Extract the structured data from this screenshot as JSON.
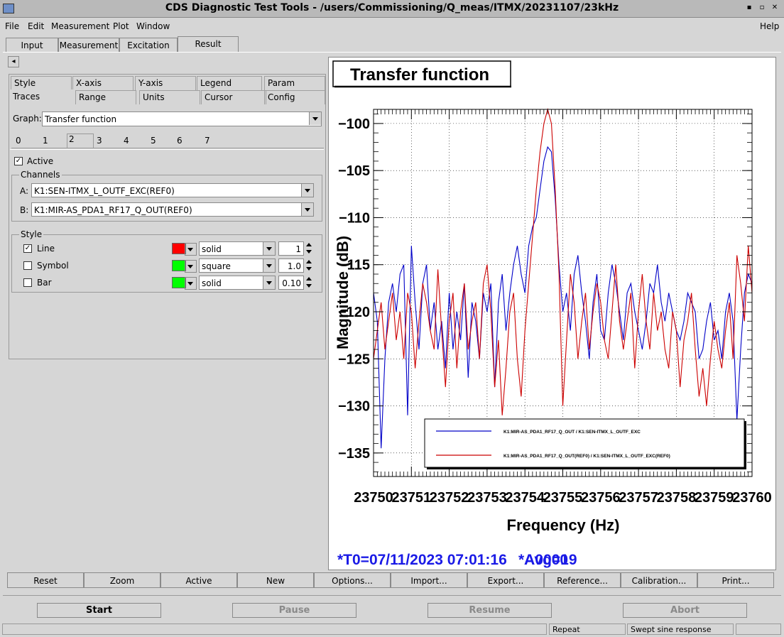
{
  "window": {
    "title": "CDS Diagnostic Test Tools - /users/Commissioning/Q_meas/ITMX/20231107/23kHz",
    "minimize": "▪",
    "maximize": "▫",
    "close": "✕"
  },
  "menu": [
    "File",
    "Edit",
    "Measurement",
    "Plot",
    "Window"
  ],
  "menu_help": "Help",
  "main_tabs": [
    "Input",
    "Measurement",
    "Excitation",
    "Result"
  ],
  "main_tab_selected": "Result",
  "nav_arrow": "◂",
  "option_tabs_row1": [
    "Style",
    "X-axis",
    "Y-axis",
    "Legend",
    "Param"
  ],
  "option_tabs_row2": [
    "Traces",
    "Range",
    "Units",
    "Cursor",
    "Config"
  ],
  "graph_label": "Graph:",
  "graph_value": "Transfer function",
  "trace_tabs": [
    "0",
    "1",
    "2",
    "3",
    "4",
    "5",
    "6",
    "7"
  ],
  "trace_selected": "2",
  "active_label": "Active",
  "active_checked": "✓",
  "channels_label": "Channels",
  "channel_a_label": "A:",
  "channel_a_value": "K1:SEN-ITMX_L_OUTF_EXC(REF0)",
  "channel_b_label": "B:",
  "channel_b_value": "K1:MIR-AS_PDA1_RF17_Q_OUT(REF0)",
  "style_label": "Style",
  "style_rows": [
    {
      "label": "Line",
      "checked": "✓",
      "color": "#ff0000",
      "type": "solid",
      "size": "1"
    },
    {
      "label": "Symbol",
      "checked": "",
      "color": "#00ff00",
      "type": "square",
      "size": "1.0"
    },
    {
      "label": "Bar",
      "checked": "",
      "color": "#00ff00",
      "type": "solid",
      "size": "0.10"
    }
  ],
  "plot": {
    "title": "Transfer function",
    "footer_text": "*T0=07/11/2023 07:01:16",
    "footer_avg": "Avg=19",
    "footer_overlap": "*A0000",
    "trace_colors": [
      "#0000c8",
      "#cc0000"
    ]
  },
  "chart_data": {
    "type": "line",
    "title": "Transfer function",
    "xlabel": "Frequency (Hz)",
    "ylabel": "Magnitude (dB)",
    "xlim": [
      23750,
      23760
    ],
    "ylim": [
      -137.5,
      -98.5
    ],
    "xticks": [
      "23750",
      "23751",
      "23752",
      "23753",
      "23754",
      "23755",
      "23756",
      "23757",
      "23758",
      "23759",
      "23760"
    ],
    "yticks": [
      "−100",
      "−105",
      "−110",
      "−115",
      "−120",
      "−125",
      "−130",
      "−135"
    ],
    "ytick_values": [
      -100,
      -105,
      -110,
      -115,
      -120,
      -125,
      -130,
      -135
    ],
    "legend_position": "bottom-right",
    "grid": true,
    "series": [
      {
        "name": "K1:MIR-AS_PDA1_RF17_Q_OUT / K1:SEN-ITMX_L_OUTF_EXC",
        "color": "#0000c8",
        "x": [
          23750.0,
          23750.1,
          23750.2,
          23750.3,
          23750.4,
          23750.5,
          23750.6,
          23750.7,
          23750.8,
          23750.9,
          23751.0,
          23751.1,
          23751.2,
          23751.3,
          23751.4,
          23751.5,
          23751.6,
          23751.7,
          23751.8,
          23751.9,
          23752.0,
          23752.1,
          23752.2,
          23752.3,
          23752.4,
          23752.5,
          23752.6,
          23752.7,
          23752.8,
          23752.9,
          23753.0,
          23753.1,
          23753.2,
          23753.3,
          23753.4,
          23753.5,
          23753.6,
          23753.7,
          23753.8,
          23753.9,
          23754.0,
          23754.1,
          23754.2,
          23754.3,
          23754.4,
          23754.5,
          23754.6,
          23754.7,
          23754.8,
          23754.9,
          23755.0,
          23755.1,
          23755.2,
          23755.3,
          23755.4,
          23755.5,
          23755.6,
          23755.7,
          23755.8,
          23755.9,
          23756.0,
          23756.1,
          23756.2,
          23756.3,
          23756.4,
          23756.5,
          23756.6,
          23756.7,
          23756.8,
          23756.9,
          23757.0,
          23757.1,
          23757.2,
          23757.3,
          23757.4,
          23757.5,
          23757.6,
          23757.7,
          23757.8,
          23757.9,
          23758.0,
          23758.1,
          23758.2,
          23758.3,
          23758.4,
          23758.5,
          23758.6,
          23758.7,
          23758.8,
          23758.9,
          23759.0,
          23759.1,
          23759.2,
          23759.3,
          23759.4,
          23759.5,
          23759.6,
          23759.7,
          23759.8,
          23759.9,
          23760.0
        ],
        "values": [
          -118,
          -121,
          -134.5,
          -125,
          -119,
          -117,
          -120,
          -116,
          -115,
          -131,
          -113,
          -119,
          -124,
          -117,
          -115,
          -122,
          -119,
          -124,
          -121,
          -126,
          -118,
          -124,
          -120,
          -123,
          -117,
          -127,
          -119,
          -121,
          -125,
          -118,
          -120,
          -117,
          -128,
          -119,
          -116,
          -122,
          -118,
          -115,
          -113,
          -116,
          -118,
          -113,
          -111,
          -110,
          -107,
          -104,
          -102.5,
          -103,
          -108,
          -115,
          -120,
          -118,
          -122,
          -116,
          -114,
          -118,
          -121,
          -125,
          -119,
          -116,
          -122,
          -123,
          -118,
          -115,
          -117,
          -120,
          -123,
          -118,
          -117,
          -120,
          -122,
          -124,
          -121,
          -117,
          -118,
          -115,
          -119,
          -121,
          -118,
          -120,
          -122,
          -123,
          -121,
          -118,
          -119,
          -120,
          -125,
          -124,
          -121,
          -119,
          -123,
          -122,
          -125,
          -120,
          -118,
          -121,
          -131.5,
          -124,
          -118,
          -116,
          -117
        ]
      },
      {
        "name": "K1:MIR-AS_PDA1_RF17_Q_OUT(REF0) / K1:SEN-ITMX_L_OUTF_EXC(REF0)",
        "color": "#cc0000",
        "x": [
          23750.0,
          23750.1,
          23750.2,
          23750.3,
          23750.4,
          23750.5,
          23750.6,
          23750.7,
          23750.8,
          23750.9,
          23751.0,
          23751.1,
          23751.2,
          23751.3,
          23751.4,
          23751.5,
          23751.6,
          23751.7,
          23751.8,
          23751.9,
          23752.0,
          23752.1,
          23752.2,
          23752.3,
          23752.4,
          23752.5,
          23752.6,
          23752.7,
          23752.8,
          23752.9,
          23753.0,
          23753.1,
          23753.2,
          23753.3,
          23753.4,
          23753.5,
          23753.6,
          23753.7,
          23753.8,
          23753.9,
          23754.0,
          23754.1,
          23754.2,
          23754.3,
          23754.4,
          23754.5,
          23754.6,
          23754.7,
          23754.8,
          23754.9,
          23755.0,
          23755.1,
          23755.2,
          23755.3,
          23755.4,
          23755.5,
          23755.6,
          23755.7,
          23755.8,
          23755.9,
          23756.0,
          23756.1,
          23756.2,
          23756.3,
          23756.4,
          23756.5,
          23756.6,
          23756.7,
          23756.8,
          23756.9,
          23757.0,
          23757.1,
          23757.2,
          23757.3,
          23757.4,
          23757.5,
          23757.6,
          23757.7,
          23757.8,
          23757.9,
          23758.0,
          23758.1,
          23758.2,
          23758.3,
          23758.4,
          23758.5,
          23758.6,
          23758.7,
          23758.8,
          23758.9,
          23759.0,
          23759.1,
          23759.2,
          23759.3,
          23759.4,
          23759.5,
          23759.6,
          23759.7,
          23759.8,
          23759.9,
          23760.0
        ],
        "values": [
          -125,
          -122,
          -119,
          -124,
          -121,
          -118,
          -123,
          -120,
          -125,
          -118,
          -120,
          -126,
          -121,
          -117,
          -119,
          -122,
          -124,
          -115.5,
          -122,
          -128,
          -121,
          -118,
          -126,
          -120,
          -117,
          -124,
          -121,
          -119,
          -125,
          -117,
          -115,
          -120,
          -128,
          -123,
          -131,
          -126,
          -120,
          -118,
          -125,
          -129,
          -122,
          -117,
          -112,
          -107,
          -103,
          -100,
          -98.5,
          -100,
          -107,
          -116,
          -130,
          -123,
          -116,
          -119,
          -125,
          -121,
          -118,
          -124,
          -120,
          -117,
          -119,
          -123,
          -125,
          -120,
          -115,
          -121,
          -124,
          -121,
          -118,
          -126,
          -120,
          -116,
          -121,
          -124,
          -118,
          -122,
          -120,
          -124,
          -126,
          -120,
          -122,
          -128,
          -123,
          -121,
          -118,
          -124,
          -129,
          -126,
          -130,
          -125,
          -121,
          -124,
          -126,
          -122,
          -119,
          -125,
          -114,
          -117,
          -121,
          -113,
          -118
        ]
      }
    ]
  },
  "action_buttons": [
    "Reset",
    "Zoom",
    "Active",
    "New",
    "Options...",
    "Import...",
    "Export...",
    "Reference...",
    "Calibration...",
    "Print..."
  ],
  "control_buttons": [
    "Start",
    "Pause",
    "Resume",
    "Abort"
  ],
  "status": {
    "mode": "Repeat",
    "type": "Swept sine response"
  }
}
